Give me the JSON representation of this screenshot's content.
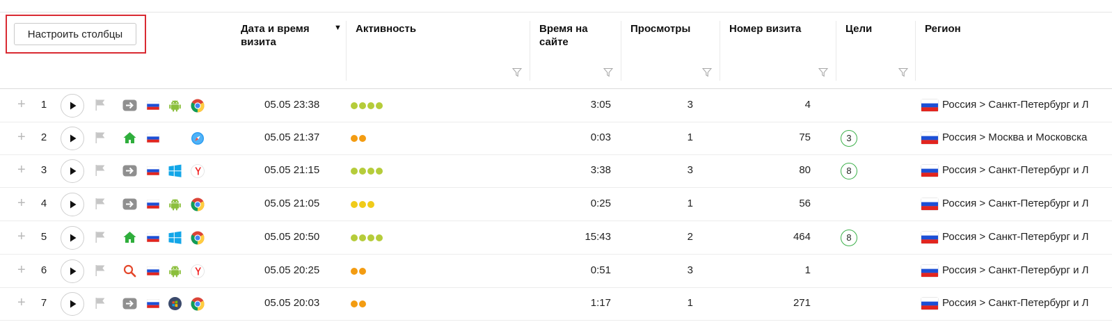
{
  "toolbar": {
    "configure_label": "Настроить столбцы"
  },
  "columns": {
    "datetime": "Дата и время визита",
    "activity": "Активность",
    "time_on_site": "Время на сайте",
    "views": "Просмотры",
    "visit_number": "Номер визита",
    "goals": "Цели",
    "region": "Регион"
  },
  "colors": {
    "lime": "#b5cc3a",
    "orange": "#f39c12",
    "yellow": "#f0cb1a",
    "goal_ring": "#3cb04a",
    "highlight": "#d92a32"
  },
  "rows": [
    {
      "n": "1",
      "source": "transition-icon",
      "os": "android-icon",
      "browser": "chrome-icon",
      "datetime": "05.05 23:38",
      "activity": 4,
      "activity_color": "lime",
      "time": "3:05",
      "views": "3",
      "visit_no": "4",
      "goals": "",
      "region": "Россия > Санкт-Петербург и Л"
    },
    {
      "n": "2",
      "source": "home-icon",
      "os": "apple-icon",
      "browser": "safari-icon",
      "datetime": "05.05 21:37",
      "activity": 2,
      "activity_color": "orange",
      "time": "0:03",
      "views": "1",
      "visit_no": "75",
      "goals": "3",
      "region": "Россия > Москва и Московска"
    },
    {
      "n": "3",
      "source": "transition-icon",
      "os": "windows-icon",
      "browser": "yandex-browser-icon",
      "datetime": "05.05 21:15",
      "activity": 4,
      "activity_color": "lime",
      "time": "3:38",
      "views": "3",
      "visit_no": "80",
      "goals": "8",
      "region": "Россия > Санкт-Петербург и Л"
    },
    {
      "n": "4",
      "source": "transition-icon",
      "os": "android-icon",
      "browser": "chrome-icon",
      "datetime": "05.05 21:05",
      "activity": 3,
      "activity_color": "yellow",
      "time": "0:25",
      "views": "1",
      "visit_no": "56",
      "goals": "",
      "region": "Россия > Санкт-Петербург и Л"
    },
    {
      "n": "5",
      "source": "home-icon",
      "os": "windows-icon",
      "browser": "chrome-icon",
      "datetime": "05.05 20:50",
      "activity": 4,
      "activity_color": "lime",
      "time": "15:43",
      "views": "2",
      "visit_no": "464",
      "goals": "8",
      "region": "Россия > Санкт-Петербург и Л"
    },
    {
      "n": "6",
      "source": "search-icon",
      "os": "android-icon",
      "browser": "yandex-browser-icon",
      "datetime": "05.05 20:25",
      "activity": 2,
      "activity_color": "orange",
      "time": "0:51",
      "views": "3",
      "visit_no": "1",
      "goals": "",
      "region": "Россия > Санкт-Петербург и Л"
    },
    {
      "n": "7",
      "source": "transition-icon",
      "os": "windows7-icon",
      "browser": "chrome-icon",
      "datetime": "05.05 20:03",
      "activity": 2,
      "activity_color": "orange",
      "time": "1:17",
      "views": "1",
      "visit_no": "271",
      "goals": "",
      "region": "Россия > Санкт-Петербург и Л"
    }
  ]
}
